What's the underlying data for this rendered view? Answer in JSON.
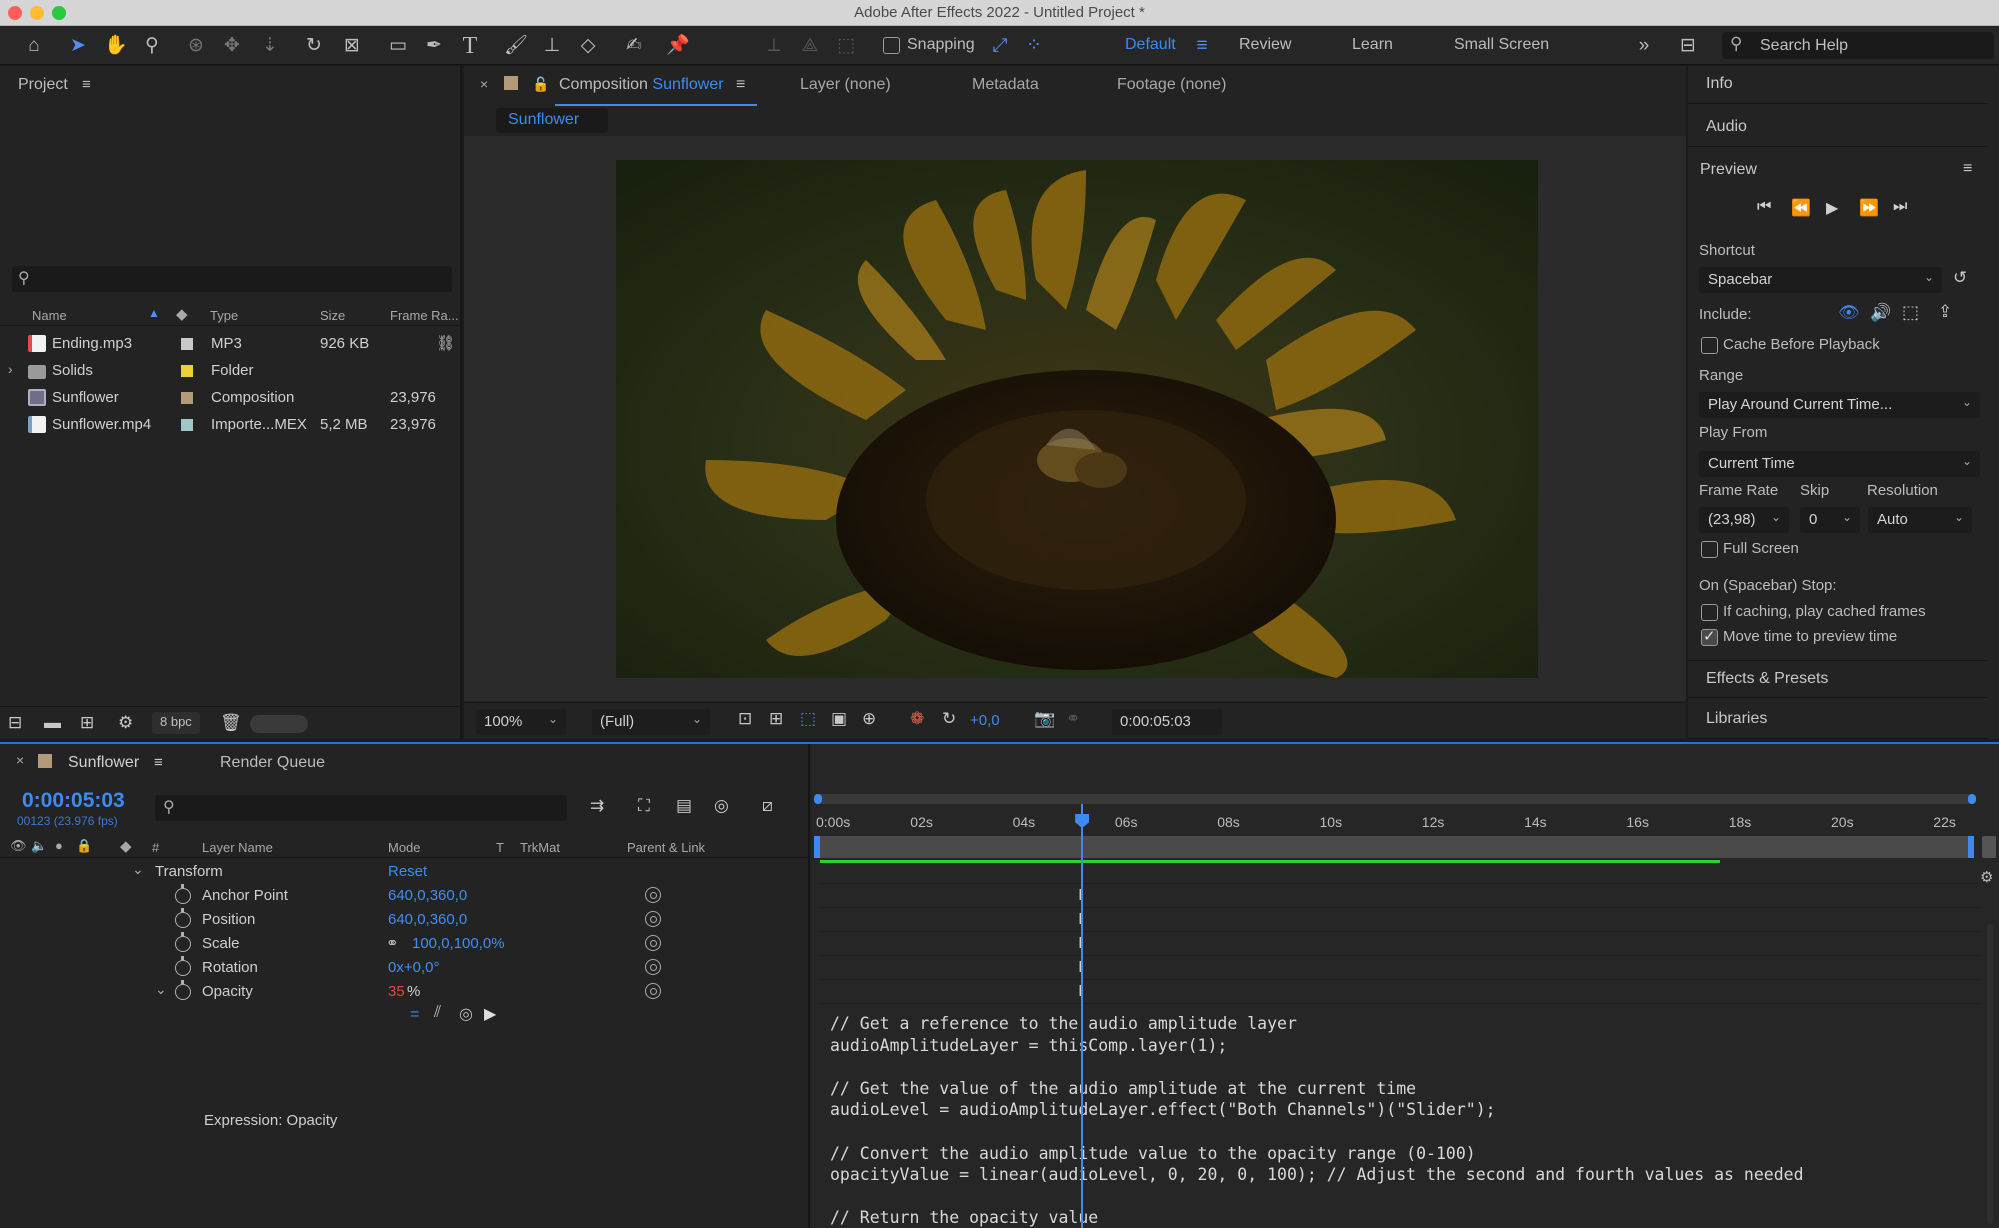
{
  "window": {
    "title": "Adobe After Effects 2022 - Untitled Project *"
  },
  "toolbar": {
    "snapping_label": "Snapping",
    "workspaces": [
      "Default",
      "Review",
      "Learn",
      "Small Screen"
    ],
    "active_workspace": "Default",
    "search_placeholder": "Search Help"
  },
  "project": {
    "title": "Project",
    "columns": {
      "name": "Name",
      "type": "Type",
      "size": "Size",
      "frame_rate": "Frame Ra..."
    },
    "items": [
      {
        "name": "Ending.mp3",
        "type": "MP3",
        "size": "926 KB",
        "frame_rate": "",
        "label_color": "#c8c8c8",
        "icon_color": "#e24b4b"
      },
      {
        "name": "Solids",
        "type": "Folder",
        "size": "",
        "frame_rate": "",
        "label_color": "#e8d23a",
        "icon_color": "#9a9a9a"
      },
      {
        "name": "Sunflower",
        "type": "Composition",
        "size": "",
        "frame_rate": "23,976",
        "label_color": "#b39b7a",
        "icon_color": "#8a8aa0"
      },
      {
        "name": "Sunflower.mp4",
        "type": "Importe...MEX",
        "size": "5,2 MB",
        "frame_rate": "23,976",
        "label_color": "#9ec8c8",
        "icon_color": "#7aa0c8"
      }
    ],
    "bpc": "8 bpc"
  },
  "composition": {
    "tab_prefix": "Composition",
    "tab_name": "Sunflower",
    "other_tabs": [
      "Layer (none)",
      "Metadata",
      "Footage (none)"
    ],
    "breadcrumb": "Sunflower",
    "zoom": "100%",
    "resolution": "(Full)",
    "exposure": "+0,0",
    "timecode": "0:00:05:03"
  },
  "right_panel": {
    "info": "Info",
    "audio": "Audio",
    "preview": "Preview",
    "shortcut_label": "Shortcut",
    "shortcut_value": "Spacebar",
    "include_label": "Include:",
    "cache_before_playback": "Cache Before Playback",
    "range_label": "Range",
    "range_value": "Play Around Current Time...",
    "play_from_label": "Play From",
    "play_from_value": "Current Time",
    "frame_rate_label": "Frame Rate",
    "skip_label": "Skip",
    "resolution_label": "Resolution",
    "frame_rate_value": "(23,98)",
    "skip_value": "0",
    "resolution_value": "Auto",
    "full_screen": "Full Screen",
    "stop_label": "On (Spacebar) Stop:",
    "if_caching": "If caching, play cached frames",
    "move_time": "Move time to preview time",
    "effects_presets": "Effects & Presets",
    "libraries": "Libraries"
  },
  "timeline": {
    "tab_name": "Sunflower",
    "render_queue": "Render Queue",
    "timecode": "0:00:05:03",
    "frame_info": "00123 (23.976 fps)",
    "columns": {
      "num": "#",
      "layer_name": "Layer Name",
      "mode": "Mode",
      "t": "T",
      "trkmat": "TrkMat",
      "parent": "Parent & Link"
    },
    "transform_label": "Transform",
    "reset_label": "Reset",
    "properties": [
      {
        "name": "Anchor Point",
        "value": "640,0,360,0"
      },
      {
        "name": "Position",
        "value": "640,0,360,0"
      },
      {
        "name": "Scale",
        "value": "100,0,100,0%"
      },
      {
        "name": "Rotation",
        "value": "0x+0,0°"
      }
    ],
    "opacity_name": "Opacity",
    "opacity_value": "35",
    "opacity_unit": "%",
    "expression_label": "Expression: Opacity",
    "ruler": [
      "0:00s",
      "02s",
      "04s",
      "06s",
      "08s",
      "10s",
      "12s",
      "14s",
      "16s",
      "18s",
      "20s",
      "22s"
    ],
    "playhead_seconds": 5.125,
    "work_area_end_seconds": 17.6,
    "code": [
      "// Get a reference to the audio amplitude layer",
      "audioAmplitudeLayer = thisComp.layer(1);",
      "",
      "// Get the value of the audio amplitude at the current time",
      "audioLevel = audioAmplitudeLayer.effect(\"Both Channels\")(\"Slider\");",
      "",
      "// Convert the audio amplitude value to the opacity range (0-100)",
      "opacityValue = linear(audioLevel, 0, 20, 0, 100); // Adjust the second and fourth values as needed",
      "",
      "// Return the opacity value"
    ]
  },
  "colors": {
    "accent": "#3d8bf0",
    "playhead": "#3d8bf0",
    "work_area": "#2fd02f"
  }
}
